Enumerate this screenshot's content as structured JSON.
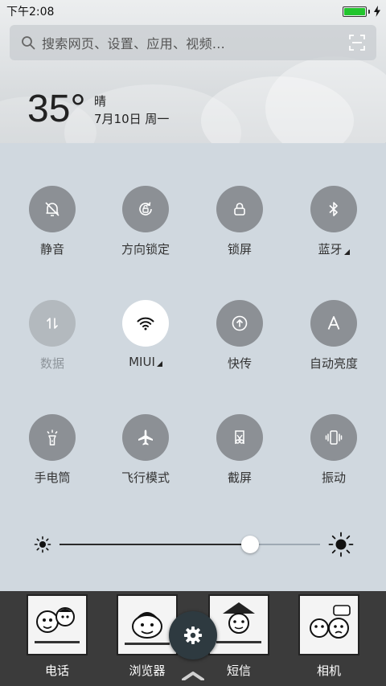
{
  "status_bar": {
    "time": "下午2:08",
    "battery_color": "#22c52d"
  },
  "search": {
    "placeholder": "搜索网页、设置、应用、视频..."
  },
  "weather": {
    "temperature": "35°",
    "condition": "晴",
    "date": "7月10日 周一"
  },
  "quick_settings": [
    {
      "label": "静音",
      "icon": "bell-off-icon",
      "state": "off"
    },
    {
      "label": "方向锁定",
      "icon": "rotation-lock-icon",
      "state": "off"
    },
    {
      "label": "锁屏",
      "icon": "lock-icon",
      "state": "off"
    },
    {
      "label": "蓝牙",
      "icon": "bluetooth-icon",
      "state": "off",
      "expandable": true
    },
    {
      "label": "数据",
      "icon": "mobile-data-icon",
      "state": "disabled"
    },
    {
      "label": "MIUI",
      "icon": "wifi-icon",
      "state": "on",
      "expandable": true
    },
    {
      "label": "快传",
      "icon": "quick-transfer-icon",
      "state": "off"
    },
    {
      "label": "自动亮度",
      "icon": "auto-brightness-icon",
      "state": "off"
    },
    {
      "label": "手电筒",
      "icon": "flashlight-icon",
      "state": "off"
    },
    {
      "label": "飞行模式",
      "icon": "airplane-icon",
      "state": "off"
    },
    {
      "label": "截屏",
      "icon": "screenshot-icon",
      "state": "off"
    },
    {
      "label": "振动",
      "icon": "vibrate-icon",
      "state": "off"
    }
  ],
  "brightness": {
    "level": 0.73
  },
  "dock": [
    {
      "label": "电话",
      "icon": "phone-app-icon"
    },
    {
      "label": "浏览器",
      "icon": "browser-app-icon"
    },
    {
      "label": "短信",
      "icon": "messages-app-icon"
    },
    {
      "label": "相机",
      "icon": "camera-app-icon"
    }
  ],
  "colors": {
    "tile_off": "#8c9095",
    "tile_on": "#ffffff",
    "panel_bg": "#d0d8df",
    "dock_bg": "#3b3b3b"
  }
}
